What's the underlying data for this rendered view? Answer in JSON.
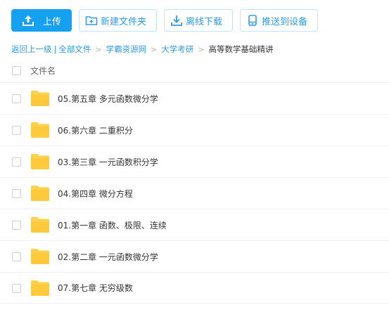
{
  "toolbar": {
    "upload_label": "上传",
    "new_folder_label": "新建文件夹",
    "offline_download_label": "离线下载",
    "push_device_label": "推送到设备"
  },
  "breadcrumb": {
    "back": "返回上一级",
    "divider": "|",
    "items": [
      "全部文件",
      "学霸资源网",
      "大学考研"
    ],
    "current": "高等数学基础精讲",
    "separator": ">"
  },
  "list": {
    "header_label": "文件名",
    "rows": [
      {
        "name": "05.第五章 多元函数微分学"
      },
      {
        "name": "06.第六章 二重积分"
      },
      {
        "name": "03.第三章 一元函数积分学"
      },
      {
        "name": "04.第四章 微分方程"
      },
      {
        "name": "01.第一章 函数、极限、连续"
      },
      {
        "name": "02.第二章 一元函数微分学"
      },
      {
        "name": "07.第七章 无穷级数"
      }
    ]
  },
  "colors": {
    "accent": "#16a0f0",
    "link": "#2e9be6",
    "folder": "#ffd24d"
  },
  "icons": [
    "upload-icon",
    "new-folder-icon",
    "download-icon",
    "device-icon",
    "folder-icon"
  ]
}
